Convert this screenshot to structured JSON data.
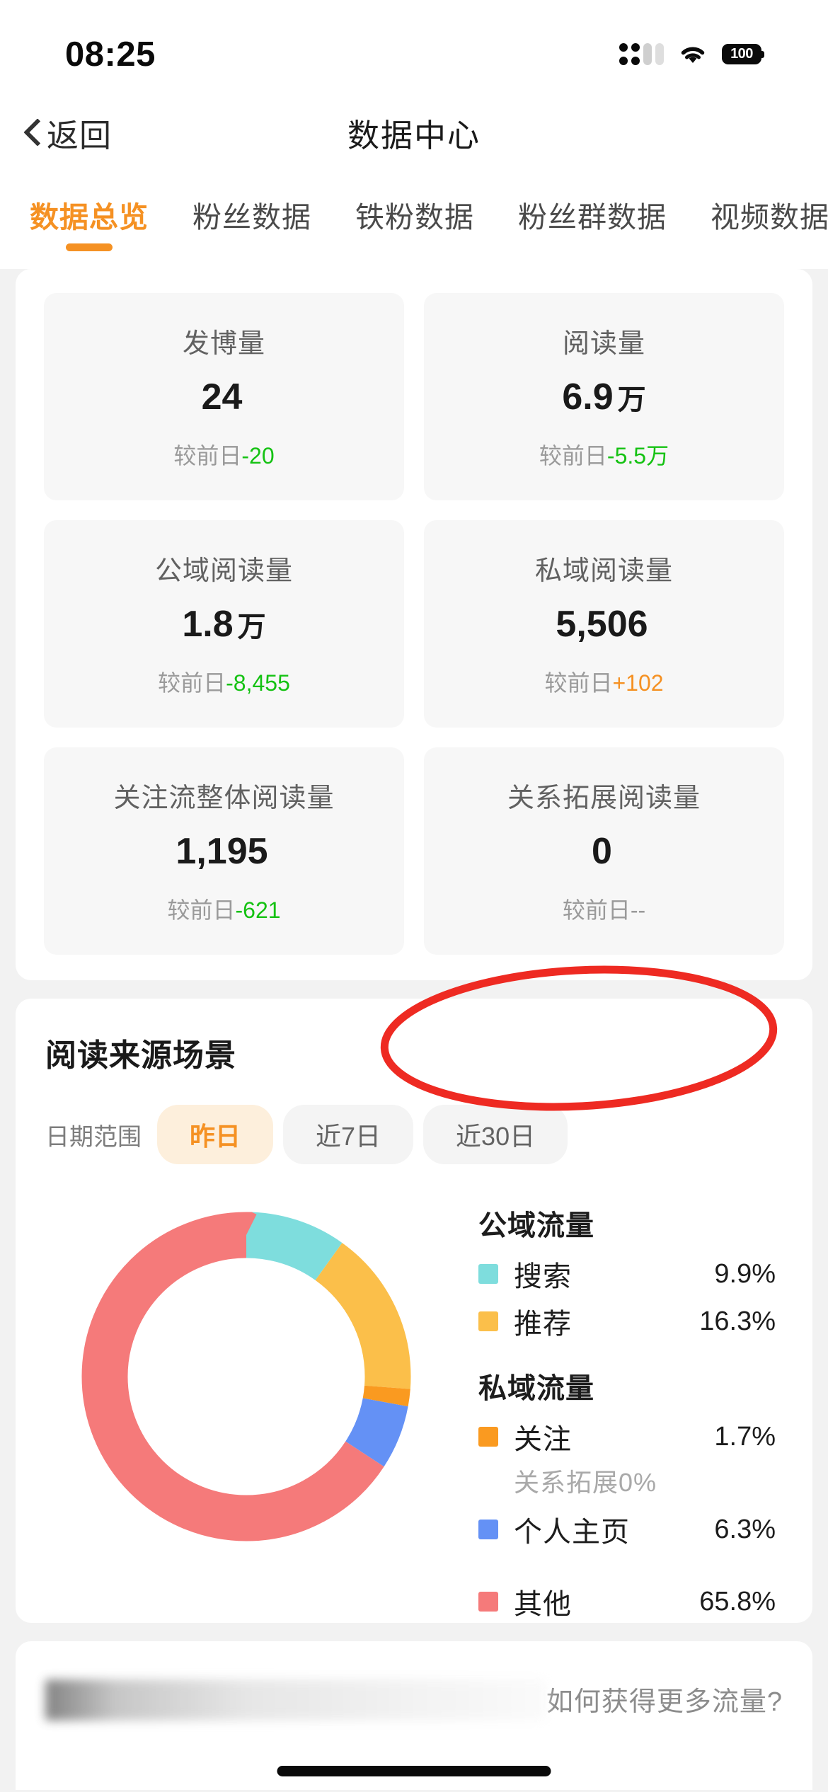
{
  "status_bar": {
    "time": "08:25",
    "battery_percent": "100",
    "signal_icon": "cellular-signal-icon",
    "wifi_icon": "wifi-icon",
    "battery_icon": "battery-icon"
  },
  "nav": {
    "back_label": "返回",
    "back_icon": "chevron-left-icon",
    "title": "数据中心"
  },
  "tabs": [
    {
      "label": "数据总览",
      "active": true
    },
    {
      "label": "粉丝数据",
      "active": false
    },
    {
      "label": "铁粉数据",
      "active": false
    },
    {
      "label": "粉丝群数据",
      "active": false
    },
    {
      "label": "视频数据",
      "active": false
    }
  ],
  "stats": [
    {
      "label": "发博量",
      "value": "24",
      "unit": "",
      "delta_prefix": "较前日",
      "delta_value": "-20",
      "delta_dir": "down"
    },
    {
      "label": "阅读量",
      "value": "6.9",
      "unit": "万",
      "delta_prefix": "较前日",
      "delta_value": "-5.5万",
      "delta_dir": "down"
    },
    {
      "label": "公域阅读量",
      "value": "1.8",
      "unit": "万",
      "delta_prefix": "较前日",
      "delta_value": "-8,455",
      "delta_dir": "down"
    },
    {
      "label": "私域阅读量",
      "value": "5,506",
      "unit": "",
      "delta_prefix": "较前日",
      "delta_value": "+102",
      "delta_dir": "up"
    },
    {
      "label": "关注流整体阅读量",
      "value": "1,195",
      "unit": "",
      "delta_prefix": "较前日",
      "delta_value": "-621",
      "delta_dir": "down"
    },
    {
      "label": "关系拓展阅读量",
      "value": "0",
      "unit": "",
      "delta_prefix": "较前日",
      "delta_value": "--",
      "delta_dir": "flat"
    }
  ],
  "source_section": {
    "title": "阅读来源场景",
    "range_label": "日期范围",
    "ranges": [
      {
        "label": "昨日",
        "active": true
      },
      {
        "label": "近7日",
        "active": false
      },
      {
        "label": "近30日",
        "active": false
      }
    ],
    "group_public": "公域流量",
    "group_private": "私域流量",
    "sub_note": "关系拓展0%"
  },
  "teaser": {
    "link_label": "如何获得更多流量?"
  },
  "colors": {
    "accent": "#F59123",
    "positive": "#F59123",
    "negative": "#15C213",
    "muted": "#9A9A9A",
    "annotation": "#EE2A22",
    "search": "#7EDDDD",
    "recommend": "#FBBF4A",
    "follow": "#FA9A20",
    "profile": "#6491F5",
    "other": "#F57A7A"
  },
  "chart_data": {
    "type": "pie",
    "title": "阅读来源场景",
    "subtitle": "昨日",
    "legend_position": "right",
    "donut": true,
    "start_angle_deg": 0,
    "direction": "clockwise",
    "categories": [
      "搜索",
      "推荐",
      "关注",
      "个人主页",
      "其他"
    ],
    "values": [
      9.9,
      16.3,
      1.7,
      6.3,
      65.8
    ],
    "value_labels": [
      "9.9%",
      "16.3%",
      "1.7%",
      "6.3%",
      "65.8%"
    ],
    "colors": [
      "#7EDDDD",
      "#FBBF4A",
      "#FA9A20",
      "#6491F5",
      "#F57A7A"
    ],
    "groups": [
      {
        "name": "公域流量",
        "categories": [
          "搜索",
          "推荐"
        ]
      },
      {
        "name": "私域流量",
        "categories": [
          "关注",
          "个人主页"
        ],
        "note": "关系拓展0%"
      },
      {
        "name": "",
        "categories": [
          "其他"
        ]
      }
    ],
    "ylabel": "",
    "xlabel": "",
    "annotation": {
      "shape": "ellipse",
      "targets": [
        "推荐",
        "16.3%"
      ],
      "color": "#EE2A22"
    }
  }
}
